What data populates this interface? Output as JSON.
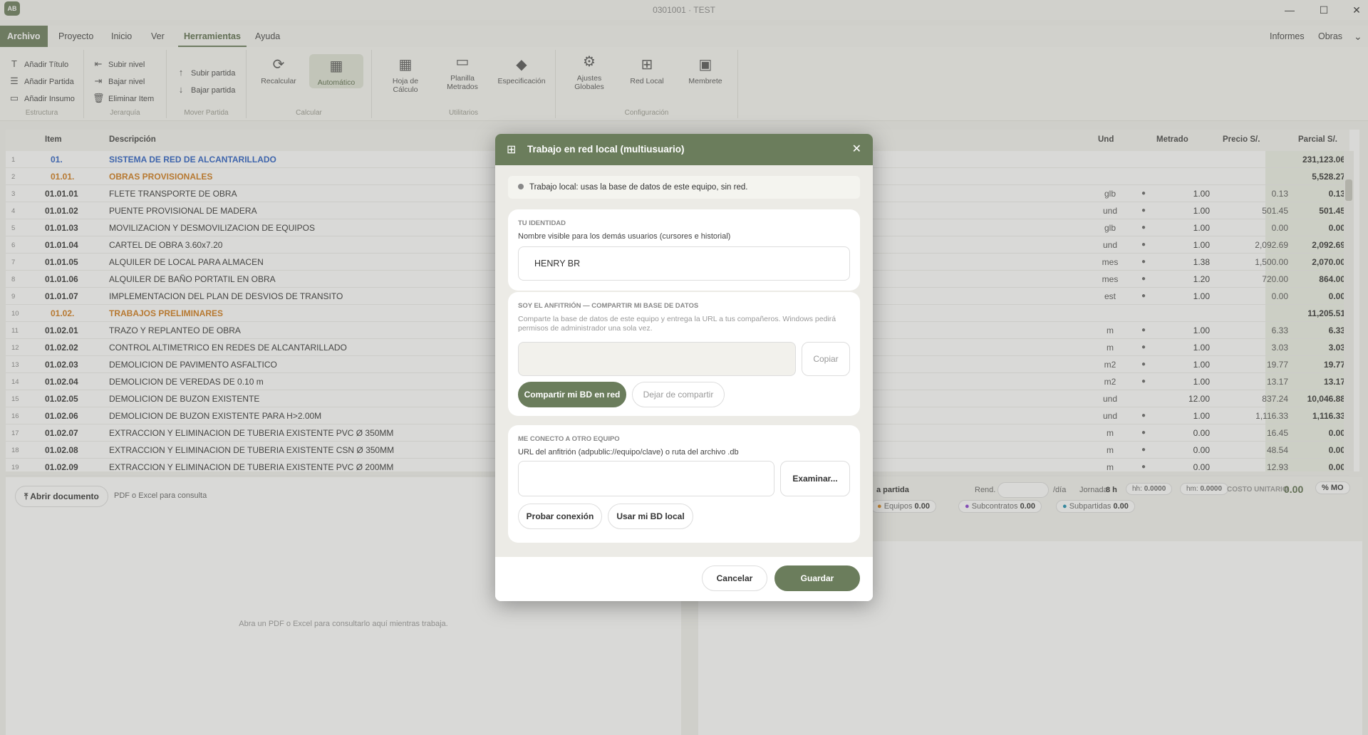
{
  "window": {
    "title": "0301001 · TEST",
    "logo": "AB",
    "minimize": "—",
    "maximize": "☐",
    "close": "✕"
  },
  "menu": {
    "items": [
      "Archivo",
      "Proyecto",
      "Inicio",
      "Ver",
      "Herramientas",
      "Ayuda"
    ],
    "right": [
      "Informes",
      "Obras"
    ]
  },
  "ribbon": {
    "estructura": {
      "label": "Estructura",
      "items": [
        "Añadir Título",
        "Añadir Partida",
        "Añadir Insumo"
      ]
    },
    "jerarquia": {
      "label": "Jerarquía",
      "items": [
        "Subir nivel",
        "Bajar nivel",
        "Eliminar Item"
      ]
    },
    "mover": {
      "label": "Mover Partida",
      "items": [
        "Subir partida",
        "Bajar partida"
      ]
    },
    "calcular": {
      "label": "Calcular",
      "items": [
        "Recalcular",
        "Automático"
      ]
    },
    "utilitarios": {
      "label": "Utilitarios",
      "items": [
        "Hoja de Cálculo",
        "Planilla Metrados",
        "Especificación"
      ]
    },
    "configuracion": {
      "label": "Configuración",
      "items": [
        "Ajustes Globales",
        "Red Local",
        "Membrete"
      ]
    }
  },
  "grid": {
    "headers": {
      "item": "Item",
      "desc": "Descripción",
      "und": "Und",
      "metrado": "Metrado",
      "precio": "Precio S/.",
      "parcial": "Parcial S/."
    },
    "rows": [
      {
        "n": "1",
        "item": "01.",
        "desc": "SISTEMA DE RED DE ALCANTARILLADO",
        "und": "",
        "met": "",
        "pre": "",
        "par": "231,123.06"
      },
      {
        "n": "2",
        "item": "01.01.",
        "desc": "OBRAS PROVISIONALES",
        "und": "",
        "met": "",
        "pre": "",
        "par": "5,528.27"
      },
      {
        "n": "3",
        "item": "01.01.01",
        "desc": "FLETE TRANSPORTE DE OBRA",
        "und": "glb",
        "met": "1.00",
        "pre": "0.13",
        "par": "0.13"
      },
      {
        "n": "4",
        "item": "01.01.02",
        "desc": "PUENTE PROVISIONAL DE MADERA",
        "und": "und",
        "met": "1.00",
        "pre": "501.45",
        "par": "501.45"
      },
      {
        "n": "5",
        "item": "01.01.03",
        "desc": "MOVILIZACION Y DESMOVILIZACION DE EQUIPOS",
        "und": "glb",
        "met": "1.00",
        "pre": "0.00",
        "par": "0.00"
      },
      {
        "n": "6",
        "item": "01.01.04",
        "desc": "CARTEL DE OBRA 3.60x7.20",
        "und": "und",
        "met": "1.00",
        "pre": "2,092.69",
        "par": "2,092.69"
      },
      {
        "n": "7",
        "item": "01.01.05",
        "desc": "ALQUILER DE LOCAL PARA ALMACEN",
        "und": "mes",
        "met": "1.38",
        "pre": "1,500.00",
        "par": "2,070.00"
      },
      {
        "n": "8",
        "item": "01.01.06",
        "desc": "ALQUILER DE BAÑO PORTATIL EN OBRA",
        "und": "mes",
        "met": "1.20",
        "pre": "720.00",
        "par": "864.00"
      },
      {
        "n": "9",
        "item": "01.01.07",
        "desc": "IMPLEMENTACION DEL PLAN DE DESVIOS DE TRANSITO",
        "und": "est",
        "met": "1.00",
        "pre": "0.00",
        "par": "0.00"
      },
      {
        "n": "10",
        "item": "01.02.",
        "desc": "TRABAJOS PRELIMINARES",
        "und": "",
        "met": "",
        "pre": "",
        "par": "11,205.51"
      },
      {
        "n": "11",
        "item": "01.02.01",
        "desc": "TRAZO Y REPLANTEO DE OBRA",
        "und": "m",
        "met": "1.00",
        "pre": "6.33",
        "par": "6.33"
      },
      {
        "n": "12",
        "item": "01.02.02",
        "desc": "CONTROL ALTIMETRICO EN REDES DE ALCANTARILLADO",
        "und": "m",
        "met": "1.00",
        "pre": "3.03",
        "par": "3.03"
      },
      {
        "n": "13",
        "item": "01.02.03",
        "desc": "DEMOLICION DE PAVIMENTO ASFALTICO",
        "und": "m2",
        "met": "1.00",
        "pre": "19.77",
        "par": "19.77"
      },
      {
        "n": "14",
        "item": "01.02.04",
        "desc": "DEMOLICION DE VEREDAS DE 0.10 m",
        "und": "m2",
        "met": "1.00",
        "pre": "13.17",
        "par": "13.17"
      },
      {
        "n": "15",
        "item": "01.02.05",
        "desc": "DEMOLICION DE BUZON EXISTENTE",
        "und": "und",
        "met": "12.00",
        "pre": "837.24",
        "par": "10,046.88"
      },
      {
        "n": "16",
        "item": "01.02.06",
        "desc": "DEMOLICION DE BUZON EXISTENTE PARA H>2.00M",
        "und": "und",
        "met": "1.00",
        "pre": "1,116.33",
        "par": "1,116.33"
      },
      {
        "n": "17",
        "item": "01.02.07",
        "desc": "EXTRACCION Y ELIMINACION DE TUBERIA EXISTENTE PVC Ø 350MM",
        "und": "m",
        "met": "0.00",
        "pre": "16.45",
        "par": "0.00"
      },
      {
        "n": "18",
        "item": "01.02.08",
        "desc": "EXTRACCION Y ELIMINACION DE TUBERIA EXISTENTE CSN Ø 350MM",
        "und": "m",
        "met": "0.00",
        "pre": "48.54",
        "par": "0.00"
      },
      {
        "n": "19",
        "item": "01.02.09",
        "desc": "EXTRACCION Y ELIMINACION DE TUBERIA EXISTENTE PVC Ø 200MM",
        "und": "m",
        "met": "0.00",
        "pre": "12.93",
        "par": "0.00"
      }
    ]
  },
  "docs": {
    "open_button": "Abrir documento",
    "hint": "PDF o Excel para consulta",
    "empty": "Abra un PDF o Excel para consultarlo aquí mientras trabaja."
  },
  "apu": {
    "partida_label": "a partida",
    "rend_label": "Rend.",
    "rend_unit": "/día",
    "jornada_label": "Jornada:",
    "jornada_value": "8 h",
    "hh_label": "hh:",
    "hh_value": "0.0000",
    "hm_label": "hm:",
    "hm_value": "0.0000",
    "costo_label": "COSTO UNITARIO",
    "costo_value": "0.00",
    "mo_button": "% MO",
    "equipos_label": "Equipos",
    "equipos_value": "0.00",
    "subcontratos_label": "Subcontratos",
    "subcontratos_value": "0.00",
    "subpartidas_label": "Subpartidas",
    "subpartidas_value": "0.00",
    "colors": {
      "equipos": "#e08a1e",
      "subcontratos": "#8a3fd1",
      "subpartidas": "#1e8fb0"
    }
  },
  "dialog": {
    "title": "Trabajo en red local (multiusuario)",
    "close": "✕",
    "status": "Trabajo local: usas la base de datos de este equipo, sin red.",
    "identity": {
      "title": "TU IDENTIDAD",
      "label": "Nombre visible para los demás usuarios (cursores e historial)",
      "value": "HENRY BR"
    },
    "host": {
      "title": "SOY EL ANFITRIÓN — COMPARTIR MI BASE DE DATOS",
      "desc": "Comparte la base de datos de este equipo y entrega la URL a tus compañeros. Windows pedirá permisos de administrador una sola vez.",
      "url_value": "",
      "copy": "Copiar",
      "share": "Compartir mi BD en red",
      "stop": "Dejar de compartir"
    },
    "connect": {
      "title": "ME CONECTO A OTRO EQUIPO",
      "label": "URL del anfitrión (adpublic://equipo/clave) o ruta del archivo .db",
      "value": "",
      "browse": "Examinar...",
      "test": "Probar conexión",
      "use_local": "Usar mi BD local"
    },
    "cancel": "Cancelar",
    "save": "Guardar"
  },
  "colors": {
    "brand": "#6b7d5c",
    "level1": "#2a5fc4",
    "level2": "#d07a1a"
  }
}
